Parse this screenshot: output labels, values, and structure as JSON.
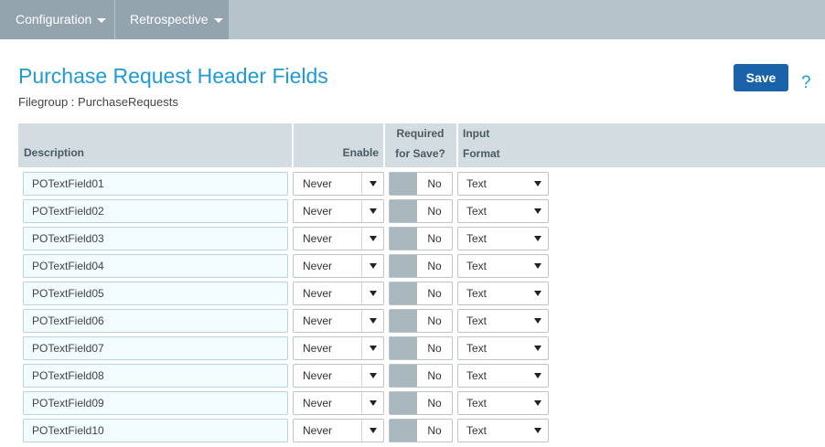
{
  "nav": {
    "items": [
      {
        "label": "Configuration"
      },
      {
        "label": "Retrospective"
      }
    ]
  },
  "page": {
    "title": "Purchase Request Header Fields",
    "subtitle": "Filegroup : PurchaseRequests",
    "save_label": "Save",
    "help_label": "?"
  },
  "table": {
    "headers": {
      "description": "Description",
      "enable": "Enable",
      "required_line1": "Required",
      "required_line2": "for Save?",
      "input_line1": "Input",
      "input_line2": "Format"
    },
    "rows": [
      {
        "description": "POTextField01",
        "enable": "Never",
        "required": "No",
        "format": "Text"
      },
      {
        "description": "POTextField02",
        "enable": "Never",
        "required": "No",
        "format": "Text"
      },
      {
        "description": "POTextField03",
        "enable": "Never",
        "required": "No",
        "format": "Text"
      },
      {
        "description": "POTextField04",
        "enable": "Never",
        "required": "No",
        "format": "Text"
      },
      {
        "description": "POTextField05",
        "enable": "Never",
        "required": "No",
        "format": "Text"
      },
      {
        "description": "POTextField06",
        "enable": "Never",
        "required": "No",
        "format": "Text"
      },
      {
        "description": "POTextField07",
        "enable": "Never",
        "required": "No",
        "format": "Text"
      },
      {
        "description": "POTextField08",
        "enable": "Never",
        "required": "No",
        "format": "Text"
      },
      {
        "description": "POTextField09",
        "enable": "Never",
        "required": "No",
        "format": "Text"
      },
      {
        "description": "POTextField10",
        "enable": "Never",
        "required": "No",
        "format": "Text"
      }
    ]
  },
  "colors": {
    "accent": "#1e9ad6",
    "primary_button": "#1b63a8",
    "nav_bar": "#b5c3cb",
    "table_header": "#d3dce0"
  }
}
